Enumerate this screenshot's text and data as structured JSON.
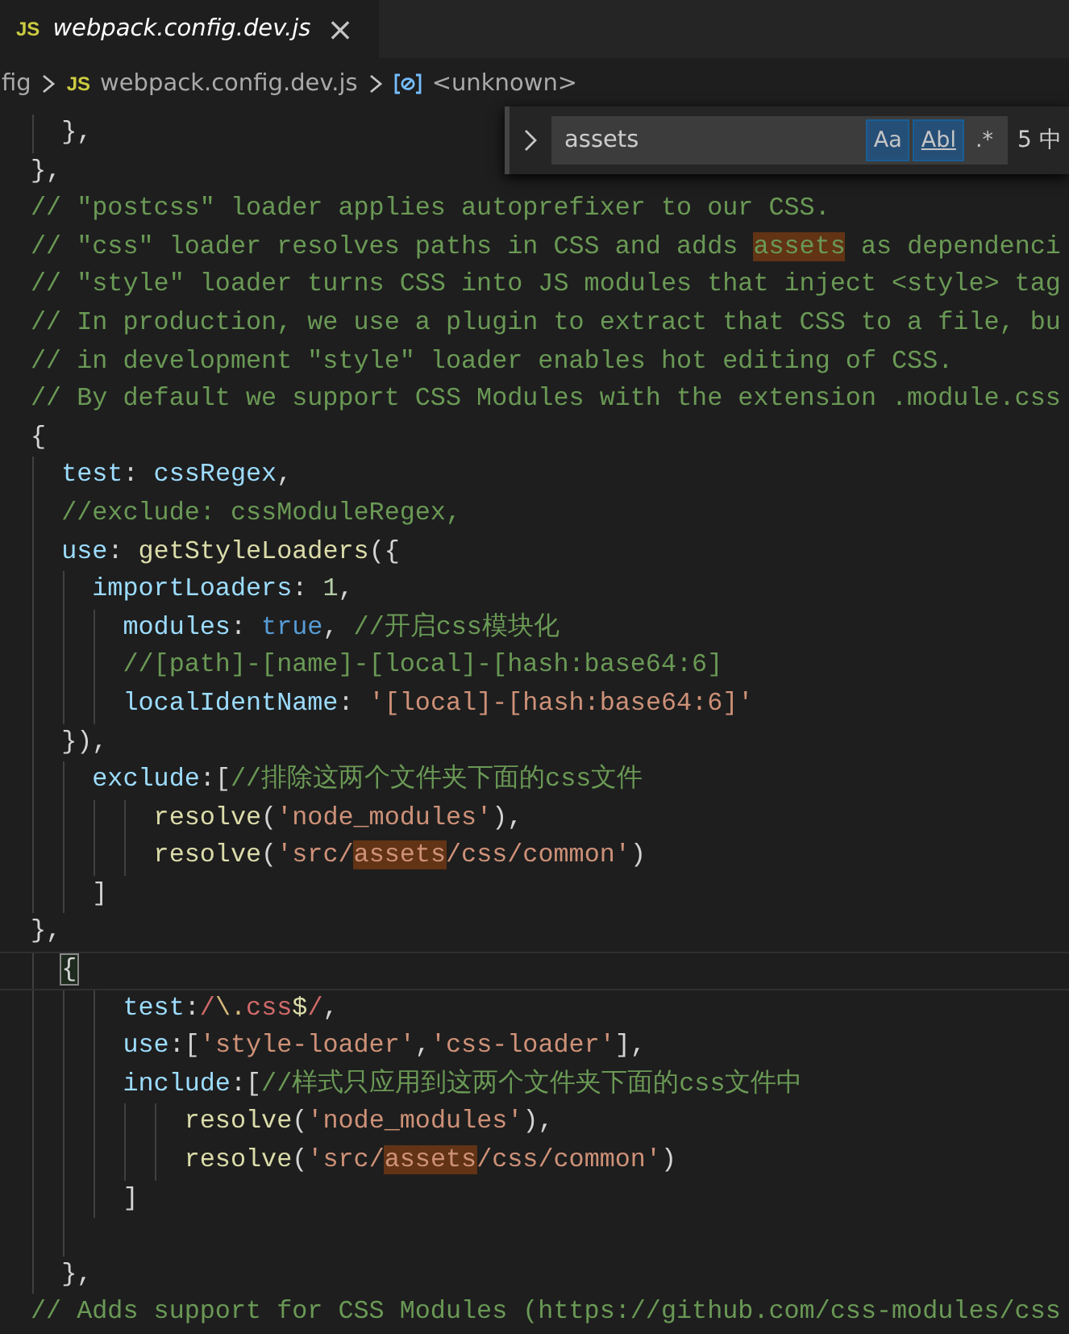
{
  "tab": {
    "icon_label": "JS",
    "title": "webpack.config.dev.js",
    "selected": true,
    "preview": true,
    "close": "×"
  },
  "breadcrumb": {
    "items": [
      {
        "kind": "folder",
        "text": "fig"
      },
      {
        "kind": "file",
        "icon_label": "JS",
        "text": "webpack.config.dev.js"
      },
      {
        "kind": "symbol",
        "text": "<unknown>"
      }
    ]
  },
  "find": {
    "value": "assets",
    "toggles": [
      {
        "label": "Aa",
        "on": true
      },
      {
        "label": "Abl",
        "on": true
      },
      {
        "label": ".*",
        "on": false
      }
    ],
    "count": "5 中"
  },
  "lines": [
    {
      "current": false,
      "segments": [
        {
          "kind": "punct",
          "text": "  },"
        }
      ]
    },
    {
      "current": false,
      "segments": [
        {
          "kind": "punct",
          "text": "},"
        }
      ]
    },
    {
      "current": false,
      "segments": [
        {
          "kind": "comment",
          "text": "// \"postcss\" loader applies autoprefixer to our CSS."
        }
      ]
    },
    {
      "current": false,
      "segments": [
        {
          "kind": "comment",
          "text": "// \"css\" loader resolves paths in CSS and adds "
        },
        {
          "kind": "comment",
          "text": "assets",
          "match": true
        },
        {
          "kind": "comment",
          "text": " as dependenci"
        }
      ]
    },
    {
      "current": false,
      "segments": [
        {
          "kind": "comment",
          "text": "// \"style\" loader turns CSS into JS modules that inject <style> tag"
        }
      ]
    },
    {
      "current": false,
      "segments": [
        {
          "kind": "comment",
          "text": "// In production, we use a plugin to extract that CSS to a file, bu"
        }
      ]
    },
    {
      "current": false,
      "segments": [
        {
          "kind": "comment",
          "text": "// in development \"style\" loader enables hot editing of CSS."
        }
      ]
    },
    {
      "current": false,
      "segments": [
        {
          "kind": "comment",
          "text": "// By default we support CSS Modules with the extension .module.css"
        }
      ]
    },
    {
      "current": false,
      "segments": [
        {
          "kind": "punct",
          "text": "{"
        }
      ]
    },
    {
      "current": false,
      "segments": [
        {
          "kind": "prop",
          "text": "  test"
        },
        {
          "kind": "punct",
          "text": ": "
        },
        {
          "kind": "prop",
          "text": "cssRegex"
        },
        {
          "kind": "punct",
          "text": ","
        }
      ]
    },
    {
      "current": false,
      "segments": [
        {
          "kind": "comment",
          "text": "  //exclude: cssModuleRegex,"
        }
      ]
    },
    {
      "current": false,
      "segments": [
        {
          "kind": "prop",
          "text": "  use"
        },
        {
          "kind": "punct",
          "text": ": "
        },
        {
          "kind": "func",
          "text": "getStyleLoaders"
        },
        {
          "kind": "punct",
          "text": "({"
        }
      ]
    },
    {
      "current": false,
      "segments": [
        {
          "kind": "prop",
          "text": "    importLoaders"
        },
        {
          "kind": "punct",
          "text": ": "
        },
        {
          "kind": "number",
          "text": "1"
        },
        {
          "kind": "punct",
          "text": ","
        }
      ]
    },
    {
      "current": false,
      "segments": [
        {
          "kind": "prop",
          "text": "      modules"
        },
        {
          "kind": "punct",
          "text": ": "
        },
        {
          "kind": "keyword",
          "text": "true"
        },
        {
          "kind": "punct",
          "text": ", "
        },
        {
          "kind": "comment",
          "text": "//开启css模块化"
        }
      ]
    },
    {
      "current": false,
      "segments": [
        {
          "kind": "comment",
          "text": "      //[path]-[name]-[local]-[hash:base64:6]"
        }
      ]
    },
    {
      "current": false,
      "segments": [
        {
          "kind": "prop",
          "text": "      localIdentName"
        },
        {
          "kind": "punct",
          "text": ": "
        },
        {
          "kind": "string",
          "text": "'[local]-[hash:base64:6]'"
        }
      ]
    },
    {
      "current": false,
      "segments": [
        {
          "kind": "punct",
          "text": "  }),"
        }
      ]
    },
    {
      "current": false,
      "segments": [
        {
          "kind": "prop",
          "text": "    exclude"
        },
        {
          "kind": "punct",
          "text": ":["
        },
        {
          "kind": "comment",
          "text": "//排除这两个文件夹下面的css文件"
        }
      ]
    },
    {
      "current": false,
      "segments": [
        {
          "kind": "func",
          "text": "        resolve"
        },
        {
          "kind": "punct",
          "text": "("
        },
        {
          "kind": "string",
          "text": "'node_modules'"
        },
        {
          "kind": "punct",
          "text": "),"
        }
      ]
    },
    {
      "current": false,
      "segments": [
        {
          "kind": "func",
          "text": "        resolve"
        },
        {
          "kind": "punct",
          "text": "("
        },
        {
          "kind": "string",
          "text": "'src/"
        },
        {
          "kind": "string",
          "text": "assets",
          "match": true
        },
        {
          "kind": "string",
          "text": "/css/common'"
        },
        {
          "kind": "punct",
          "text": ")"
        }
      ]
    },
    {
      "current": false,
      "segments": [
        {
          "kind": "punct",
          "text": "    ]"
        }
      ]
    },
    {
      "current": false,
      "segments": [
        {
          "kind": "punct",
          "text": "},"
        }
      ]
    },
    {
      "current": true,
      "segments": [
        {
          "kind": "punct",
          "text": "  {",
          "bracket_match": true
        }
      ]
    },
    {
      "current": false,
      "segments": [
        {
          "kind": "prop",
          "text": "      test"
        },
        {
          "kind": "punct",
          "text": ":"
        },
        {
          "kind": "regex",
          "text": "/"
        },
        {
          "kind": "regex-escape",
          "text": "\\."
        },
        {
          "kind": "regex",
          "text": "css"
        },
        {
          "kind": "regex-anchor",
          "text": "$"
        },
        {
          "kind": "regex",
          "text": "/"
        },
        {
          "kind": "punct",
          "text": ","
        }
      ]
    },
    {
      "current": false,
      "segments": [
        {
          "kind": "prop",
          "text": "      use"
        },
        {
          "kind": "punct",
          "text": ":["
        },
        {
          "kind": "string",
          "text": "'style-loader'"
        },
        {
          "kind": "punct",
          "text": ","
        },
        {
          "kind": "string",
          "text": "'css-loader'"
        },
        {
          "kind": "punct",
          "text": "],"
        }
      ]
    },
    {
      "current": false,
      "segments": [
        {
          "kind": "prop",
          "text": "      include"
        },
        {
          "kind": "punct",
          "text": ":["
        },
        {
          "kind": "comment",
          "text": "//样式只应用到这两个文件夹下面的css文件中"
        }
      ]
    },
    {
      "current": false,
      "segments": [
        {
          "kind": "func",
          "text": "          resolve"
        },
        {
          "kind": "punct",
          "text": "("
        },
        {
          "kind": "string",
          "text": "'node_modules'"
        },
        {
          "kind": "punct",
          "text": "),"
        }
      ]
    },
    {
      "current": false,
      "segments": [
        {
          "kind": "func",
          "text": "          resolve"
        },
        {
          "kind": "punct",
          "text": "("
        },
        {
          "kind": "string",
          "text": "'src/"
        },
        {
          "kind": "string",
          "text": "assets",
          "match": true
        },
        {
          "kind": "string",
          "text": "/css/common'"
        },
        {
          "kind": "punct",
          "text": ")"
        }
      ]
    },
    {
      "current": false,
      "segments": [
        {
          "kind": "punct",
          "text": "      ]"
        }
      ]
    },
    {
      "current": false
    },
    {
      "current": false,
      "segments": [
        {
          "kind": "punct",
          "text": "  },"
        }
      ]
    },
    {
      "current": false,
      "segments": [
        {
          "kind": "comment",
          "text": "// Adds support for CSS Modules (https://github.com/css-modules/css"
        }
      ]
    }
  ]
}
